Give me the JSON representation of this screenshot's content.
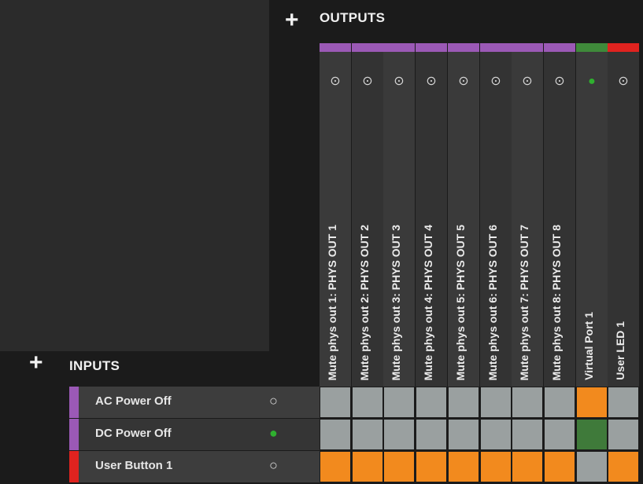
{
  "outputs": {
    "title": "OUTPUTS",
    "add_label": "+",
    "columns": [
      {
        "label": "Mute phys out 1: PHYS OUT 1",
        "icon": "lightbulb-off-icon",
        "active": false,
        "group_color": "#9b59b6"
      },
      {
        "label": "Mute phys out 2: PHYS OUT 2",
        "icon": "lightbulb-off-icon",
        "active": false,
        "group_color": "#9b59b6"
      },
      {
        "label": "Mute phys out 3: PHYS OUT 3",
        "icon": "lightbulb-off-icon",
        "active": false,
        "group_color": "#9b59b6"
      },
      {
        "label": "Mute phys out 4: PHYS OUT 4",
        "icon": "lightbulb-off-icon",
        "active": false,
        "group_color": "#9b59b6"
      },
      {
        "label": "Mute phys out 5: PHYS OUT 5",
        "icon": "lightbulb-off-icon",
        "active": false,
        "group_color": "#9b59b6"
      },
      {
        "label": "Mute phys out 6: PHYS OUT 6",
        "icon": "lightbulb-off-icon",
        "active": false,
        "group_color": "#9b59b6"
      },
      {
        "label": "Mute phys out 7: PHYS OUT 7",
        "icon": "lightbulb-off-icon",
        "active": false,
        "group_color": "#9b59b6"
      },
      {
        "label": "Mute phys out 8: PHYS OUT 8",
        "icon": "lightbulb-off-icon",
        "active": false,
        "group_color": "#9b59b6"
      },
      {
        "label": "Virtual Port 1",
        "icon": "lightbulb-on-icon",
        "active": true,
        "group_color": "#3f8a3a"
      },
      {
        "label": "User LED 1",
        "icon": "lightbulb-off-icon",
        "active": false,
        "group_color": "#e0231f"
      }
    ]
  },
  "inputs": {
    "title": "INPUTS",
    "add_label": "+",
    "rows": [
      {
        "label": "AC Power Off",
        "icon": "lightbulb-off-icon",
        "active": false,
        "group_color": "#9b59b6"
      },
      {
        "label": "DC Power Off",
        "icon": "lightbulb-on-icon",
        "active": true,
        "group_color": "#9b59b6"
      },
      {
        "label": "User Button 1",
        "icon": "lightbulb-off-icon",
        "active": false,
        "group_color": "#e0231f"
      }
    ]
  },
  "matrix": [
    [
      "off",
      "off",
      "off",
      "off",
      "off",
      "off",
      "off",
      "off",
      "on",
      "off"
    ],
    [
      "off",
      "off",
      "off",
      "off",
      "off",
      "off",
      "off",
      "off",
      "linked",
      "off"
    ],
    [
      "on",
      "on",
      "on",
      "on",
      "on",
      "on",
      "on",
      "on",
      "off",
      "on"
    ]
  ],
  "colors": {
    "background": "#1b1b1b",
    "cell_off": "#9aa0a0",
    "cell_on": "#f28a1e",
    "cell_linked": "#3f7a3a",
    "indicator_active": "#2fb02f"
  }
}
